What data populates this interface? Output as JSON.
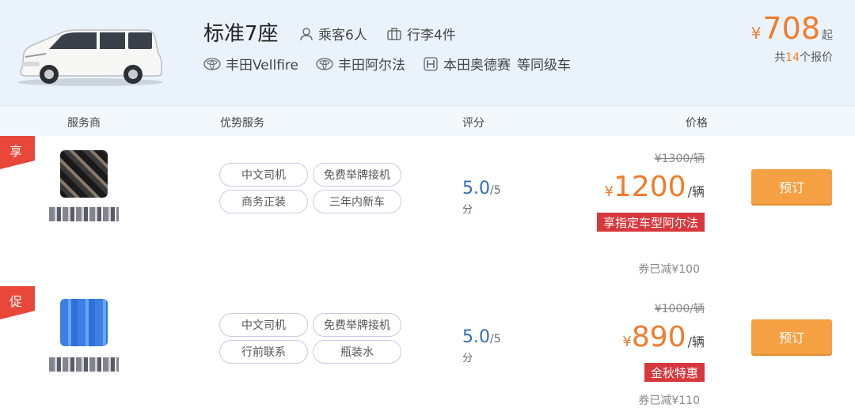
{
  "car": {
    "title": "标准7座",
    "passengers": "乘客6人",
    "luggage": "行李4件",
    "models": [
      {
        "name": "丰田Vellfire",
        "icon": "toyota-logo-icon"
      },
      {
        "name": "丰田阿尔法",
        "icon": "toyota-logo-icon"
      },
      {
        "name": "本田奥德赛",
        "icon": "honda-logo-icon"
      }
    ],
    "models_suffix": "等同级车",
    "start_price": {
      "currency": "¥",
      "amount": "708",
      "suffix": "起"
    },
    "quote_count": {
      "prefix": "共",
      "count": "14",
      "suffix": "个报价"
    }
  },
  "columns": {
    "provider": "服务商",
    "services": "优势服务",
    "rating": "评分",
    "price": "价格"
  },
  "offers": [
    {
      "flag": "享",
      "tags": [
        "中文司机",
        "免费举牌接机",
        "商务正装",
        "三年内新车"
      ],
      "rating": "5.0",
      "rating_max": "/5",
      "rating_unit": "分",
      "original_price": "¥1300/辆",
      "price_currency": "¥",
      "price": "1200",
      "price_unit": "/辆",
      "promo": "享指定车型阿尔法",
      "coupon": "券已减¥100",
      "book_label": "预订"
    },
    {
      "flag": "促",
      "tags": [
        "中文司机",
        "免费举牌接机",
        "行前联系",
        "瓶装水"
      ],
      "rating": "5.0",
      "rating_max": "/5",
      "rating_unit": "分",
      "original_price": "¥1000/辆",
      "price_currency": "¥",
      "price": "890",
      "price_unit": "/辆",
      "promo": "金秋特惠",
      "coupon": "券已减¥110",
      "book_label": "预订"
    }
  ],
  "colors": {
    "accent": "#f07c2c",
    "promo": "#d8383d",
    "button": "#f5a043",
    "rating": "#2f6fb8"
  }
}
